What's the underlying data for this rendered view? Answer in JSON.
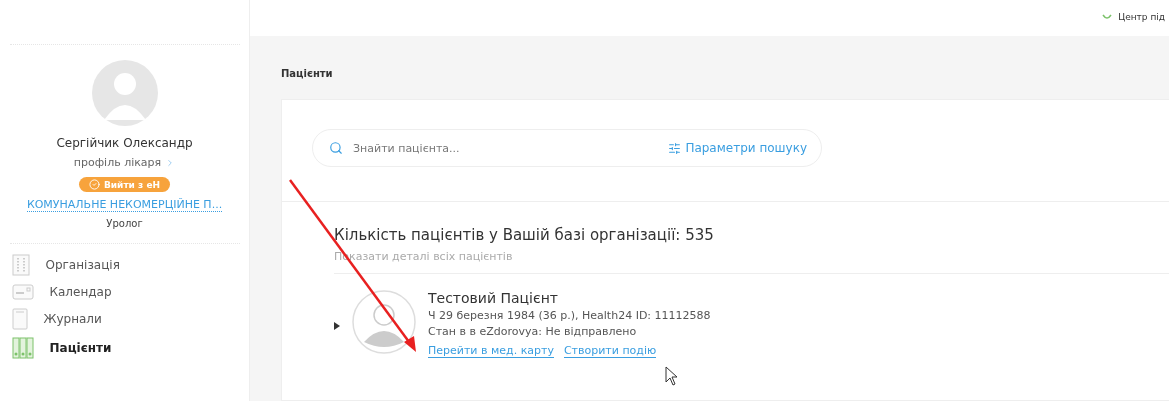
{
  "header": {
    "support_link": "Центр під"
  },
  "sidebar": {
    "user_name": "Сергійчик Олександр",
    "profile_link": "профіль лікаря",
    "logout_badge": "Вийти з еН",
    "organization": "КОМУНАЛЬНЕ НЕКОМЕРЦІЙНЕ П...",
    "specialty": "Уролог",
    "menu": [
      {
        "kind": "organization",
        "label": "Організація",
        "selected": false
      },
      {
        "kind": "calendar",
        "label": "Календар",
        "selected": false
      },
      {
        "kind": "journal",
        "label": "Журнали",
        "selected": false
      },
      {
        "kind": "patients",
        "label": "Пацієнти",
        "selected": true
      }
    ]
  },
  "main": {
    "breadcrumb": "Пацієнти",
    "search": {
      "placeholder": "Знайти пацієнта...",
      "filters_button": "Параметри пошуку"
    },
    "summary": {
      "title": "Кількість пацієнтів у Вашій базі організації: 535",
      "details_link": "Показати деталі всіх пацієнтів"
    },
    "patients": [
      {
        "name": "Тестовий Пацієнт",
        "info": "Ч 29 березня 1984 (36 р.), Health24 ID: 11112588",
        "status": "Стан в в eZdorovya: Не відправлено",
        "expanded": false,
        "actions": [
          "Перейти в мед. карту",
          "Створити подію"
        ]
      }
    ]
  }
}
